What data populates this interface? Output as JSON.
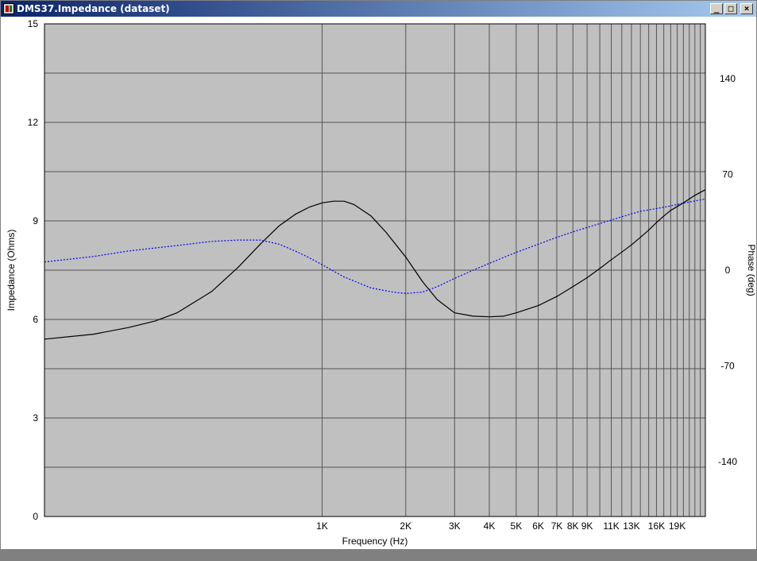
{
  "window": {
    "title": "DMS37.Impedance (dataset)",
    "minimize_label": "_",
    "maximize_label": "□",
    "close_label": "×"
  },
  "colors": {
    "plot_bg": "#c0c0c0",
    "grid": "#555555",
    "impedance": "#000000",
    "phase": "#0000ff"
  },
  "chart_data": {
    "type": "line",
    "xlabel": "Frequency (Hz)",
    "ylabel": "Impedance (Ohms)",
    "y2label": "Phase (deg)",
    "x_scale": "log",
    "xlim": [
      100,
      24000
    ],
    "ylim": [
      0,
      15
    ],
    "y2lim": [
      -180,
      180
    ],
    "x_ticks": [
      {
        "value": 1000,
        "label": "1K"
      },
      {
        "value": 2000,
        "label": "2K"
      },
      {
        "value": 3000,
        "label": "3K"
      },
      {
        "value": 4000,
        "label": "4K"
      },
      {
        "value": 5000,
        "label": "5K"
      },
      {
        "value": 6000,
        "label": "6K"
      },
      {
        "value": 7000,
        "label": "7K"
      },
      {
        "value": 8000,
        "label": "8K"
      },
      {
        "value": 9000,
        "label": "9K"
      },
      {
        "value": 11000,
        "label": "11K"
      },
      {
        "value": 13000,
        "label": "13K"
      },
      {
        "value": 16000,
        "label": "16K"
      },
      {
        "value": 19000,
        "label": "19K"
      }
    ],
    "x_grid": [
      1000,
      2000,
      3000,
      4000,
      5000,
      6000,
      7000,
      8000,
      9000,
      10000,
      11000,
      12000,
      13000,
      14000,
      15000,
      16000,
      17000,
      18000,
      19000,
      20000,
      21000,
      22000,
      23000
    ],
    "y_ticks": [
      0,
      3,
      6,
      9,
      12,
      15
    ],
    "y2_ticks": [
      -140,
      -70,
      0,
      70,
      140
    ],
    "y_grid": [
      0,
      1.5,
      3,
      4.5,
      6,
      7.5,
      9,
      10.5,
      12,
      13.5,
      15
    ],
    "series": [
      {
        "id": "impedance",
        "axis": "left",
        "style": "solid",
        "x": [
          100,
          150,
          200,
          250,
          300,
          400,
          500,
          600,
          700,
          800,
          900,
          1000,
          1100,
          1200,
          1300,
          1500,
          1700,
          2000,
          2300,
          2600,
          3000,
          3500,
          4000,
          4500,
          5000,
          6000,
          7000,
          8000,
          9000,
          10000,
          11000,
          12000,
          13000,
          14000,
          15000,
          16000,
          17000,
          18000,
          20000,
          22000,
          24000
        ],
        "y": [
          5.4,
          5.55,
          5.75,
          5.95,
          6.2,
          6.85,
          7.6,
          8.3,
          8.85,
          9.2,
          9.42,
          9.55,
          9.6,
          9.6,
          9.5,
          9.15,
          8.65,
          7.9,
          7.15,
          6.6,
          6.2,
          6.1,
          6.08,
          6.1,
          6.2,
          6.42,
          6.7,
          7.0,
          7.27,
          7.55,
          7.82,
          8.05,
          8.27,
          8.5,
          8.72,
          8.95,
          9.15,
          9.32,
          9.55,
          9.78,
          9.95
        ]
      },
      {
        "id": "phase",
        "axis": "right",
        "style": "dotted",
        "x": [
          100,
          150,
          200,
          300,
          400,
          500,
          600,
          700,
          800,
          900,
          1000,
          1200,
          1500,
          1800,
          2000,
          2300,
          2600,
          3000,
          3500,
          4000,
          5000,
          6000,
          7000,
          8000,
          10000,
          12000,
          14000,
          16000,
          18000,
          20000,
          24000
        ],
        "y": [
          6,
          10,
          14,
          18,
          21,
          22,
          22,
          19,
          14,
          9,
          4,
          -5,
          -13,
          -16,
          -17,
          -16,
          -12,
          -6,
          0,
          5,
          13,
          19,
          24,
          28,
          34,
          39,
          43,
          45,
          47,
          49,
          52
        ]
      }
    ]
  }
}
